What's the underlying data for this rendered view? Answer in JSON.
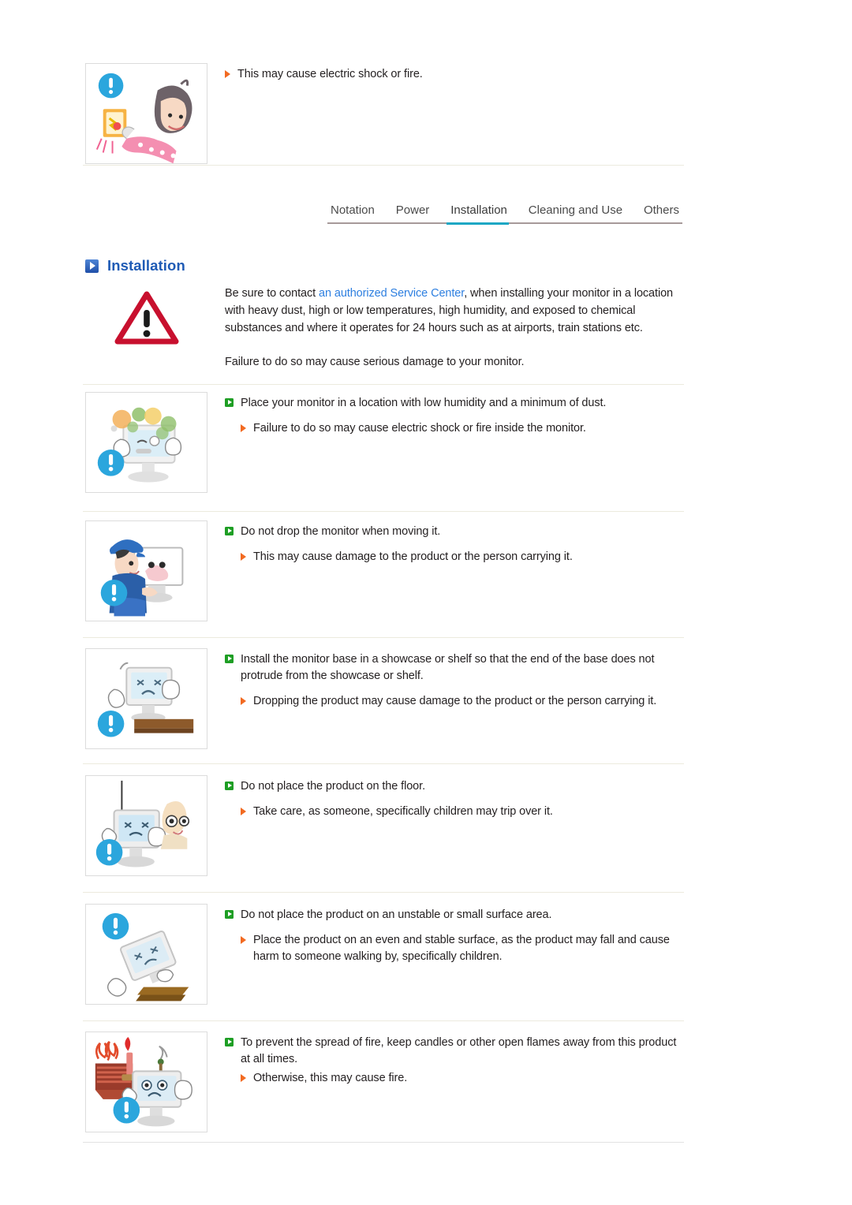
{
  "document": {
    "title": "Installation",
    "heading_icon": "play-square-icon"
  },
  "tabs": {
    "items": [
      {
        "label": "Notation",
        "active": false
      },
      {
        "label": "Power",
        "active": false
      },
      {
        "label": "Installation",
        "active": true
      },
      {
        "label": "Cleaning and Use",
        "active": false
      },
      {
        "label": "Others",
        "active": false
      }
    ],
    "active_underline_color": "#1aa7c4",
    "rule_color": "#a79a9a"
  },
  "top_block": {
    "image_alt": "woman-unplugging-wet-outlet-illustration",
    "badge_icon": "blue-exclamation-circle-icon",
    "sub_bullets": [
      "This may cause electric shock or fire."
    ]
  },
  "warning": {
    "icon": "red-warning-triangle-icon",
    "paragraph_1_before_link": "Be sure to contact ",
    "paragraph_1_link": "an authorized Service Center",
    "paragraph_1_after_link": ", when installing your monitor in a location with heavy dust, high or low temperatures, high humidity, and exposed to chemical substances and where it operates for 24 hours such as at airports, train stations etc.",
    "paragraph_2": "Failure to do so may cause serious damage to your monitor.",
    "link_color": "#2d7fe0"
  },
  "sections": [
    {
      "image_alt": "monitor-surrounded-by-dust-particles-illustration",
      "badge_icon": "blue-exclamation-circle-icon",
      "main": "Place your monitor in a location with low humidity and a minimum of dust.",
      "sub": [
        "Failure to do so may cause electric shock or fire inside the monitor."
      ]
    },
    {
      "image_alt": "man-in-blue-cap-carrying-monitor-illustration",
      "badge_icon": "blue-exclamation-circle-icon",
      "main": "Do not drop the monitor when moving it.",
      "sub": [
        "This may cause damage to the product or the person carrying it."
      ]
    },
    {
      "image_alt": "monitor-base-protruding-from-shelf-illustration",
      "badge_icon": "blue-exclamation-circle-icon",
      "main": "Install the monitor base in a showcase or shelf so that the end of the base does not protrude from the showcase or shelf.",
      "sub": [
        "Dropping the product may cause damage to the product or the person carrying it."
      ]
    },
    {
      "image_alt": "child-tripping-over-monitor-on-floor-illustration",
      "badge_icon": "blue-exclamation-circle-icon",
      "main": "Do not place the product on the floor.",
      "sub": [
        "Take care, as someone, specifically children may trip over it."
      ]
    },
    {
      "image_alt": "monitor-falling-off-small-unstable-stand-illustration",
      "badge_icon": "blue-exclamation-circle-icon",
      "main": "Do not place the product on an unstable or small surface area.",
      "sub": [
        "Place the product on an even and stable surface, as the product may fall and cause harm to someone walking by, specifically children."
      ]
    },
    {
      "image_alt": "candle-and-heater-flames-next-to-monitor-illustration",
      "badge_icon": "blue-exclamation-circle-icon",
      "main": "To prevent the spread of fire, keep candles or other open flames away from this product at all times.",
      "sub": [
        "Otherwise, this may cause fire."
      ]
    }
  ],
  "colors": {
    "bullet_green": "#1e9e24",
    "bullet_orange": "#f26a21",
    "heading_blue": "#1f5bb5",
    "divider_cream": "#eceade",
    "divider_gray": "#e2e2e2",
    "badge_blue": "#2ba6dd",
    "warning_red": "#c8102e"
  }
}
